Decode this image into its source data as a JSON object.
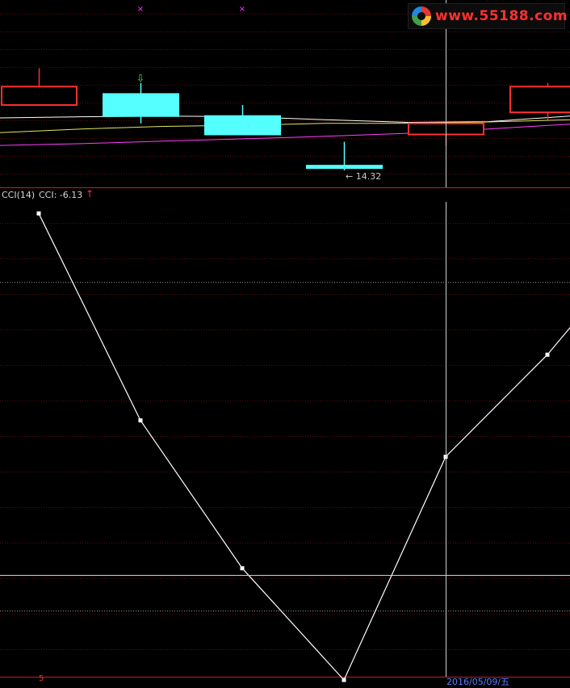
{
  "logo": {
    "text": "www.55188.com",
    "icon": "logo-ring-icon"
  },
  "price_panel": {
    "candles": [
      {
        "open": 16.1,
        "close": 16.6,
        "high": 17.1,
        "low": 16.1,
        "color": "#ff3030",
        "filled": false
      },
      {
        "open": 15.8,
        "close": 16.4,
        "high": 16.7,
        "low": 15.6,
        "color": "#55ffff",
        "filled": true,
        "up_arrow": true
      },
      {
        "open": 15.3,
        "close": 15.8,
        "high": 16.1,
        "low": 15.3,
        "color": "#55ffff",
        "filled": true
      },
      {
        "open": 14.45,
        "close": 14.45,
        "high": 15.1,
        "low": 14.32,
        "color": "#55ffff",
        "filled": true
      },
      {
        "open": 15.3,
        "close": 15.6,
        "high": 15.6,
        "low": 15.0,
        "color": "#ff3030",
        "filled": false
      },
      {
        "open": 15.9,
        "close": 16.6,
        "high": 16.7,
        "low": 15.7,
        "color": "#ff3030",
        "filled": false
      }
    ],
    "ma_lines": [
      {
        "color": "#ffffff",
        "values": [
          15.75,
          15.78,
          15.8,
          15.78,
          15.7,
          15.63,
          15.65,
          15.8
        ]
      },
      {
        "color": "#e6e660",
        "values": [
          15.35,
          15.45,
          15.52,
          15.55,
          15.6,
          15.6,
          15.64,
          15.7
        ]
      },
      {
        "color": "#ff40ff",
        "values": [
          15.0,
          15.05,
          15.12,
          15.18,
          15.25,
          15.33,
          15.45,
          15.58
        ]
      }
    ],
    "low_label": "14.32",
    "top_markers": [
      "×",
      "×"
    ]
  },
  "indicator_panel": {
    "title": "CCI(14)",
    "value_text": "CCI: -6.13",
    "arrow": "↑",
    "ylim": [
      -140,
      150
    ],
    "guide_levels": [
      100,
      -100
    ],
    "points": [
      142,
      16,
      -74,
      -142,
      -6.13,
      56,
      130
    ]
  },
  "cursor": {
    "date_label": "2016/05/09/五"
  },
  "axis_tick": "5"
}
